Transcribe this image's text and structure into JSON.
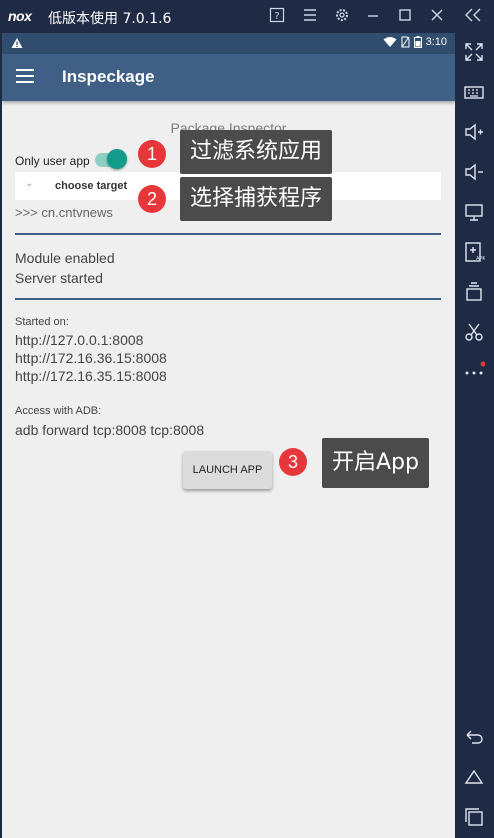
{
  "window": {
    "logo": "nox",
    "title": "低版本使用 7.0.1.6",
    "icons": [
      "help-icon",
      "menu-icon",
      "settings-icon",
      "minimize-icon",
      "maximize-icon",
      "close-icon",
      "collapse-icon"
    ]
  },
  "status_bar": {
    "time": "3:10"
  },
  "app_bar": {
    "title": "Inspeckage"
  },
  "main": {
    "heading": "Package Inspector",
    "only_user_label": "Only user app",
    "only_user_enabled": true,
    "select_placeholder": "choose target",
    "selected_package": ">>> cn.cntvnews",
    "module_status": "Module enabled",
    "server_status": "Server started",
    "started_on_label": "Started on:",
    "urls": [
      "http://127.0.0.1:8008",
      "http://172.16.36.15:8008",
      "http://172.16.35.15:8008"
    ],
    "adb_label": "Access with ADB:",
    "adb_command": "adb forward tcp:8008 tcp:8008",
    "launch_button": "LAUNCH APP"
  },
  "annotations": [
    {
      "number": "1",
      "text": "过滤系统应用"
    },
    {
      "number": "2",
      "text": "选择捕获程序"
    },
    {
      "number": "3",
      "text": "开启App"
    }
  ],
  "colors": {
    "emulator_chrome": "#1f2a44",
    "status_bar": "#304d6d",
    "app_bar": "#3f5f85",
    "toggle_accent": "#139c8c",
    "badge": "#e8373a",
    "callout": "#4b4b4b"
  }
}
